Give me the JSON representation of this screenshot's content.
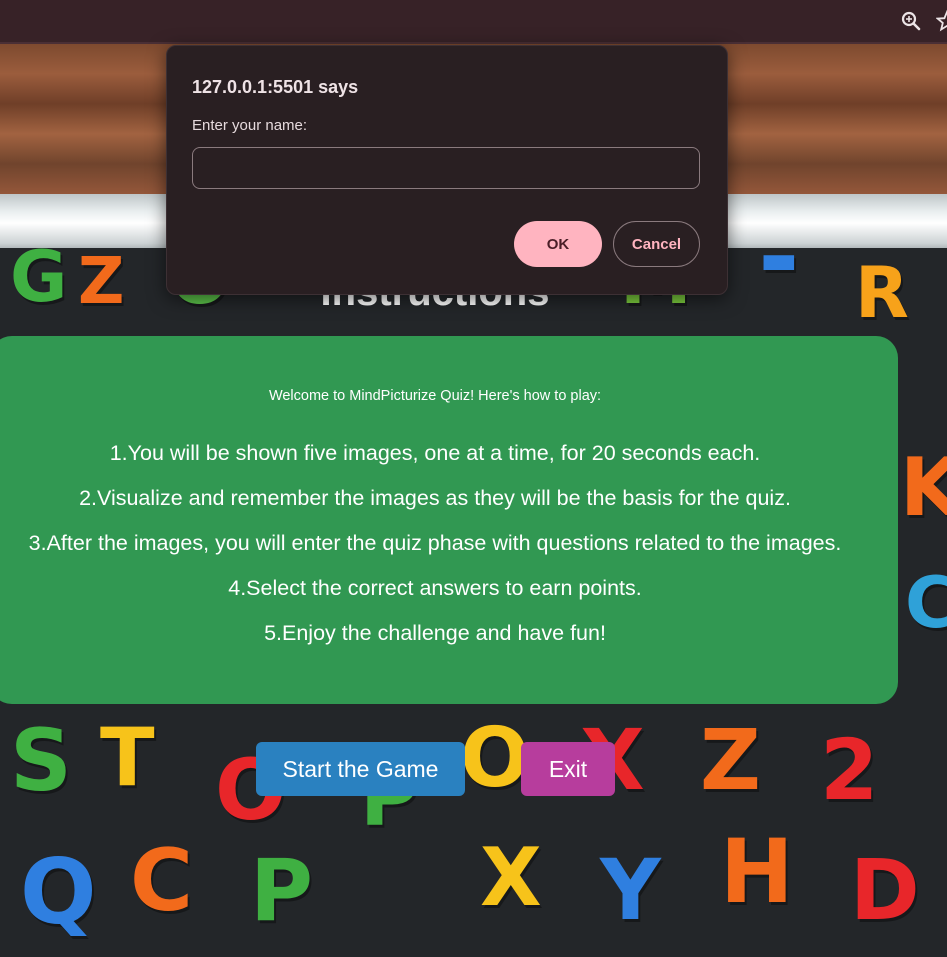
{
  "browser": {
    "toolbar_icons": [
      "zoom-icon",
      "bookmark-star-icon"
    ]
  },
  "dialog": {
    "title": "127.0.0.1:5501 says",
    "message": "Enter your name:",
    "input_value": "",
    "ok_label": "OK",
    "cancel_label": "Cancel",
    "colors": {
      "background": "#291f22",
      "ok_button": "#ffb4c0",
      "cancel_text": "#ffb4c0"
    }
  },
  "page": {
    "title": "Instructions",
    "intro": "Welcome to MindPicturize Quiz! Here's how to play:",
    "steps": [
      "1.You will be shown five images, one at a time, for 20 seconds each.",
      "2.Visualize and remember the images as they will be the basis for the quiz.",
      "3.After the images, you will enter the quiz phase with questions related to the images.",
      "4.Select the correct answers to earn points.",
      "5.Enjoy the challenge and have fun!"
    ],
    "start_button": "Start the Game",
    "exit_button": "Exit",
    "colors": {
      "panel": "#34b25c",
      "start_button": "#2a81c0",
      "exit_button": "#b73d9d"
    }
  }
}
